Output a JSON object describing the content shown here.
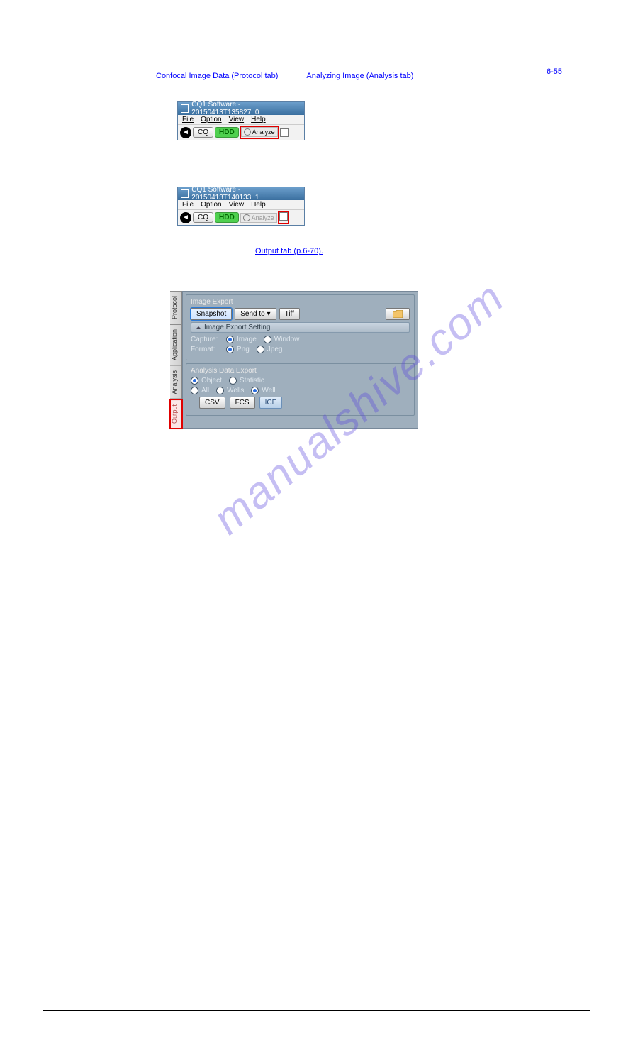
{
  "toc": {
    "item1": "Confocal Image Data (Protocol tab)",
    "item2": "Analyzing Image (Analysis tab)"
  },
  "page_ref": "6-55",
  "section_link": "Output tab (p.6-70).",
  "watermark": "manualshive.com",
  "window1": {
    "title": "CQ1 Software - 20150413T135827_0",
    "menus": {
      "file": "File",
      "option": "Option",
      "view": "View",
      "help": "Help"
    },
    "cq": "CQ",
    "hdd": "HDD",
    "analyze": "Analyze"
  },
  "window2": {
    "title": "CQ1 Software - 20150413T140133_1",
    "menus": {
      "file": "File",
      "option": "Option",
      "view": "View",
      "help": "Help"
    },
    "cq": "CQ",
    "hdd": "HDD",
    "analyze": "Analyze"
  },
  "panel": {
    "tabs": {
      "protocol": "Protocol",
      "application": "Application",
      "analysis": "Analysis",
      "output": "Output"
    },
    "image_export": {
      "title": "Image Export",
      "snapshot": "Snapshot",
      "sendto": "Send to",
      "tiff": "Tiff",
      "setting_header": "Image Export Setting",
      "capture_label": "Capture:",
      "capture_image": "Image",
      "capture_window": "Window",
      "format_label": "Format:",
      "format_png": "Png",
      "format_jpeg": "Jpeg"
    },
    "analysis_export": {
      "title": "Analysis Data Export",
      "object": "Object",
      "statistic": "Statistic",
      "all": "All",
      "wells": "Wells",
      "well": "Well",
      "csv": "CSV",
      "fcs": "FCS",
      "ice": "ICE"
    }
  }
}
